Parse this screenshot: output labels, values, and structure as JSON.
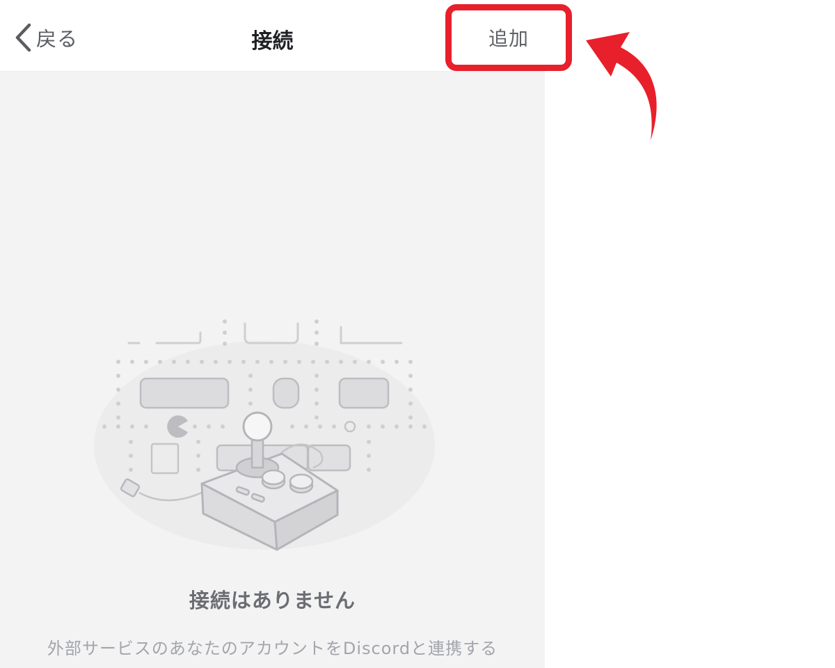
{
  "header": {
    "back_label": "戻る",
    "title": "接続",
    "add_label": "追加"
  },
  "empty_state": {
    "title": "接続はありません",
    "description": "外部サービスのあなたのアカウントをDiscordと連携する"
  },
  "icons": {
    "back": "chevron-left-icon",
    "illustration": "arcade-joystick-illustration",
    "annotation": "red-curved-arrow-icon"
  },
  "colors": {
    "highlight": "#e8202b",
    "panel_bg": "#f3f3f4",
    "header_bg": "#ffffff",
    "title_text": "#1f2023",
    "muted_text": "#a3a5aa"
  }
}
